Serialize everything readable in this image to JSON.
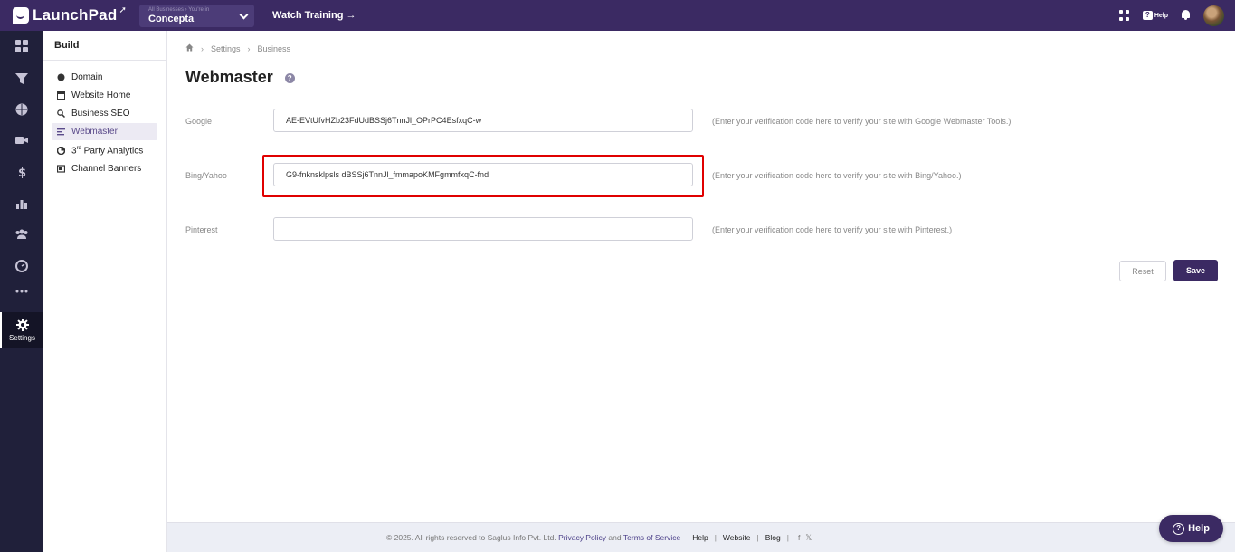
{
  "topbar": {
    "logo_text": "LaunchPad",
    "business_selector": {
      "small_label": "All Businesses › You're in",
      "value": "Concepta"
    },
    "watch_training": "Watch Training →",
    "help_label": "Help"
  },
  "rail": {
    "items": [
      "dashboard-icon",
      "funnel-icon",
      "globe-icon",
      "video-icon",
      "dollar-icon",
      "analytics-icon",
      "users-icon",
      "gauge-icon",
      "more-icon"
    ],
    "settings_label": "Settings"
  },
  "subnav": {
    "title": "Build",
    "items": [
      {
        "label": "Domain",
        "icon": "domain-icon"
      },
      {
        "label": "Website Home",
        "icon": "website-icon"
      },
      {
        "label": "Business SEO",
        "icon": "seo-icon"
      },
      {
        "label": "Webmaster",
        "icon": "webmaster-icon",
        "active": true
      },
      {
        "label": "3",
        "sup": "rd",
        "rest": " Party Analytics",
        "icon": "analytics-pie-icon"
      },
      {
        "label": "Channel Banners",
        "icon": "banner-icon"
      }
    ]
  },
  "breadcrumb": {
    "items": [
      "Settings",
      "Business"
    ]
  },
  "page": {
    "title": "Webmaster"
  },
  "form": {
    "google": {
      "label": "Google",
      "value": "AE-EVtUfvHZb23FdUdBSSj6TnnJl_OPrPC4EsfxqC-w",
      "hint": "(Enter your verification code here to verify your site with Google Webmaster Tools.)"
    },
    "bing": {
      "label": "Bing/Yahoo",
      "value": "G9-fnknsklpsls dBSSj6TnnJl_fmmapoKMFgmmfxqC-fnd",
      "hint": "(Enter your verification code here to verify your site with Bing/Yahoo.)"
    },
    "pinterest": {
      "label": "Pinterest",
      "value": "",
      "hint": "(Enter your verification code here to verify your site with Pinterest.)"
    },
    "reset_label": "Reset",
    "save_label": "Save"
  },
  "footer": {
    "copyright": "©  2025. All rights reserved to Saglus Info Pvt. Ltd.",
    "privacy": "Privacy Policy",
    "and": "and",
    "terms": "Terms of Service",
    "help": "Help",
    "website": "Website",
    "blog": "Blog",
    "facebook": "f",
    "x": "𝕏"
  },
  "help_fab": {
    "label": "Help"
  },
  "colors": {
    "primary": "#3b2a63",
    "rail": "#20203a",
    "highlight": "#e00000"
  }
}
